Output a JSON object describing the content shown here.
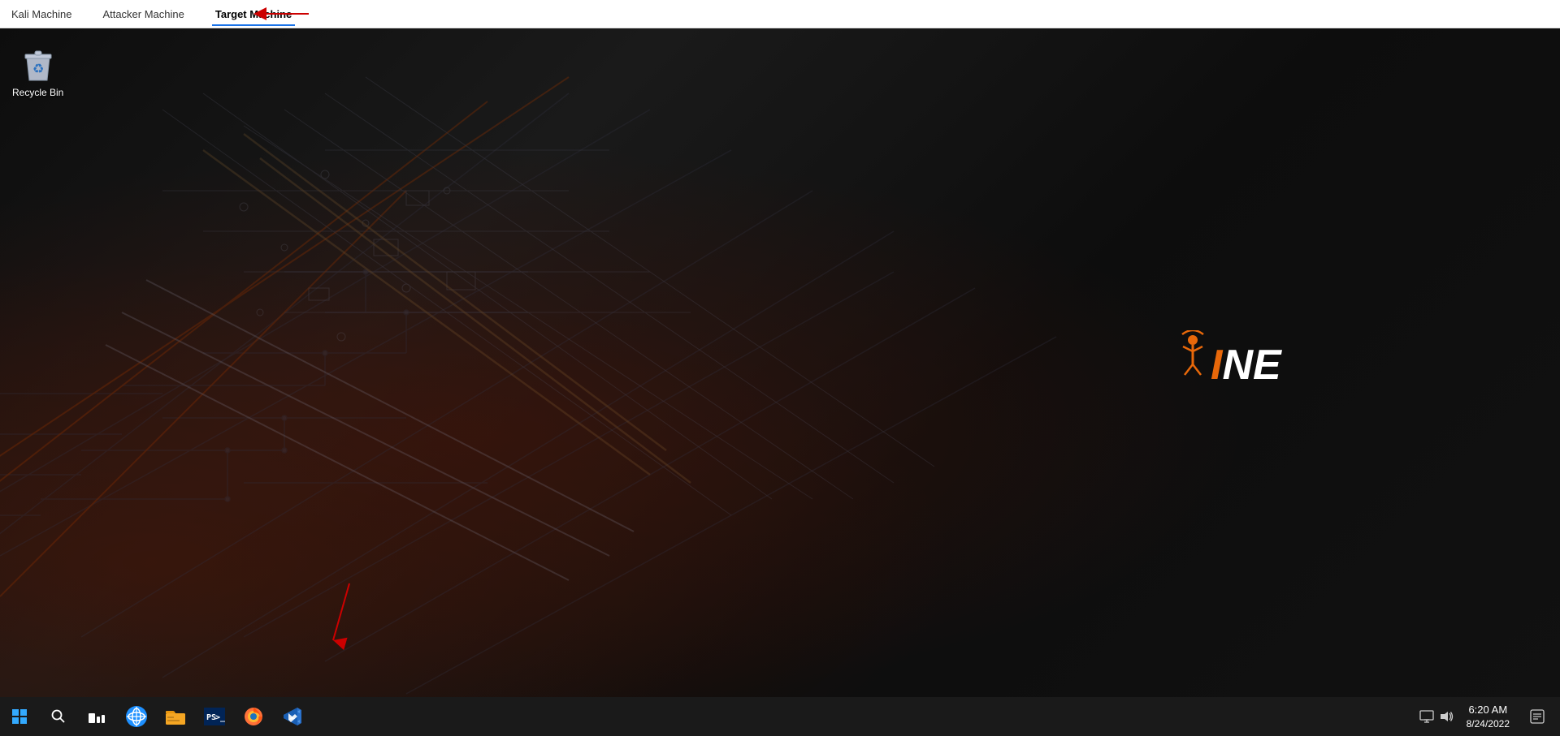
{
  "nav": {
    "tabs": [
      {
        "id": "kali",
        "label": "Kali Machine",
        "active": false
      },
      {
        "id": "attacker",
        "label": "Attacker Machine",
        "active": false
      },
      {
        "id": "target",
        "label": "Target Machine",
        "active": true
      }
    ]
  },
  "desktop": {
    "icons": [
      {
        "id": "recycle-bin",
        "label": "Recycle Bin"
      }
    ]
  },
  "ine_logo": {
    "text": "INE"
  },
  "taskbar": {
    "apps": [
      {
        "id": "start",
        "label": "Start"
      },
      {
        "id": "search",
        "label": "Search"
      },
      {
        "id": "taskview",
        "label": "Task View"
      },
      {
        "id": "ie",
        "label": "Internet Explorer"
      },
      {
        "id": "fileexplorer",
        "label": "File Explorer"
      },
      {
        "id": "powershell",
        "label": "PowerShell"
      },
      {
        "id": "firefox",
        "label": "Firefox"
      },
      {
        "id": "vscode",
        "label": "Visual Studio Code"
      }
    ],
    "tray": {
      "time": "6:20 AM",
      "date": "8/24/2022"
    }
  }
}
